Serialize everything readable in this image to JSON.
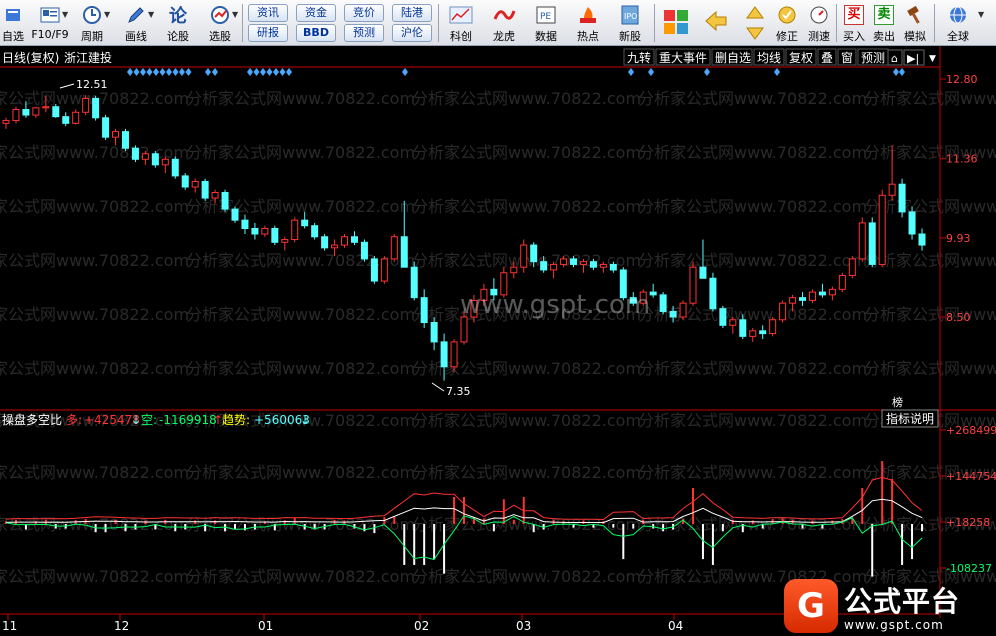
{
  "toolbar": {
    "buttons": [
      {
        "label": "自选",
        "icon": "star-icon"
      },
      {
        "label": "F10/F9",
        "icon": "info-icon"
      },
      {
        "label": "周期",
        "icon": "clock-icon"
      },
      {
        "label": "画线",
        "icon": "pencil-icon"
      },
      {
        "label": "论股",
        "icon": "discuss-icon"
      },
      {
        "label": "选股",
        "icon": "select-icon"
      }
    ],
    "small": [
      "资讯",
      "资金",
      "竞价",
      "陆港",
      "研报",
      "BBD",
      "预测",
      "沪伦"
    ],
    "buttons2": [
      {
        "label": "科创",
        "icon": "chart-icon"
      },
      {
        "label": "龙虎",
        "icon": "dragon-icon"
      },
      {
        "label": "数据",
        "icon": "pe-icon"
      },
      {
        "label": "热点",
        "icon": "hot-icon"
      },
      {
        "label": "新股",
        "icon": "ipo-icon"
      }
    ],
    "right": [
      {
        "label": "修正",
        "icon": "modify-icon"
      },
      {
        "label": "测速",
        "icon": "speed-icon"
      },
      {
        "label": "买入",
        "icon": "buy-icon",
        "glyph": "买"
      },
      {
        "label": "卖出",
        "icon": "sell-icon",
        "glyph": "卖"
      },
      {
        "label": "模拟",
        "icon": "hammer-icon"
      },
      {
        "label": "全球",
        "icon": "globe-icon"
      }
    ]
  },
  "chart": {
    "period_label": "日线(复权)",
    "stock_name": "浙江建投",
    "menu": [
      "九转",
      "重大事件",
      "删自选",
      "均线",
      "复权",
      "叠",
      "窗",
      "预测"
    ],
    "price_axis": [
      "12.80",
      "11.36",
      "9.93",
      "8.50"
    ],
    "high_label": "12.51",
    "low_label": "7.35",
    "indicator": {
      "name": "操盘多空比",
      "bull_label": "多:",
      "bull_value": "+425478",
      "bear_label": "空:",
      "bear_value": "-1169918",
      "trend_label": "趋势:",
      "trend_value": "+560063",
      "axis": [
        "+268499",
        "+144754",
        "+18258",
        "-108237"
      ],
      "explain": "指标说明",
      "tag": "榜"
    },
    "date_axis": [
      "11",
      "12",
      "01",
      "02",
      "03",
      "04"
    ],
    "watermark": "分析家公式网www.70822.com",
    "site_watermark": "www.gspt.com",
    "colors": {
      "up": "#ff3333",
      "down": "#54ffff",
      "axis": "#c00000"
    }
  },
  "chart_data": {
    "type": "candlestick",
    "price_range": [
      7.0,
      13.0
    ],
    "high": 12.51,
    "low": 7.35,
    "candles": [
      [
        12.0,
        12.1,
        11.9,
        12.05
      ],
      [
        12.05,
        12.3,
        12.0,
        12.25
      ],
      [
        12.25,
        12.4,
        12.1,
        12.15
      ],
      [
        12.15,
        12.3,
        12.1,
        12.28
      ],
      [
        12.28,
        12.5,
        12.2,
        12.3
      ],
      [
        12.3,
        12.35,
        12.1,
        12.12
      ],
      [
        12.12,
        12.2,
        11.95,
        12.0
      ],
      [
        12.0,
        12.25,
        11.98,
        12.2
      ],
      [
        12.2,
        12.51,
        12.15,
        12.45
      ],
      [
        12.45,
        12.5,
        12.05,
        12.1
      ],
      [
        12.1,
        12.15,
        11.7,
        11.75
      ],
      [
        11.75,
        11.9,
        11.6,
        11.85
      ],
      [
        11.85,
        11.9,
        11.5,
        11.55
      ],
      [
        11.55,
        11.6,
        11.3,
        11.35
      ],
      [
        11.35,
        11.5,
        11.25,
        11.45
      ],
      [
        11.45,
        11.5,
        11.2,
        11.25
      ],
      [
        11.25,
        11.4,
        11.1,
        11.35
      ],
      [
        11.35,
        11.4,
        11.0,
        11.05
      ],
      [
        11.05,
        11.1,
        10.8,
        10.85
      ],
      [
        10.85,
        11.0,
        10.75,
        10.95
      ],
      [
        10.95,
        11.0,
        10.6,
        10.65
      ],
      [
        10.65,
        10.8,
        10.55,
        10.75
      ],
      [
        10.75,
        10.8,
        10.4,
        10.45
      ],
      [
        10.45,
        10.5,
        10.2,
        10.25
      ],
      [
        10.25,
        10.35,
        10.0,
        10.1
      ],
      [
        10.1,
        10.2,
        9.9,
        10.0
      ],
      [
        10.0,
        10.15,
        9.95,
        10.1
      ],
      [
        10.1,
        10.15,
        9.8,
        9.85
      ],
      [
        9.85,
        9.95,
        9.7,
        9.9
      ],
      [
        9.9,
        10.3,
        9.85,
        10.25
      ],
      [
        10.25,
        10.4,
        10.1,
        10.15
      ],
      [
        10.15,
        10.2,
        9.9,
        9.95
      ],
      [
        9.95,
        10.0,
        9.7,
        9.75
      ],
      [
        9.75,
        9.9,
        9.6,
        9.8
      ],
      [
        9.8,
        10.0,
        9.75,
        9.95
      ],
      [
        9.95,
        10.05,
        9.8,
        9.85
      ],
      [
        9.85,
        9.9,
        9.5,
        9.55
      ],
      [
        9.55,
        9.6,
        9.1,
        9.15
      ],
      [
        9.15,
        9.6,
        9.1,
        9.55
      ],
      [
        9.55,
        10.0,
        9.5,
        9.95
      ],
      [
        9.95,
        10.6,
        9.9,
        9.4
      ],
      [
        9.4,
        9.5,
        8.8,
        8.85
      ],
      [
        8.85,
        9.0,
        8.3,
        8.4
      ],
      [
        8.4,
        8.5,
        7.9,
        8.05
      ],
      [
        8.05,
        8.2,
        7.35,
        7.6
      ],
      [
        7.6,
        8.1,
        7.5,
        8.05
      ],
      [
        8.05,
        8.6,
        8.0,
        8.5
      ],
      [
        8.5,
        8.9,
        8.4,
        8.8
      ],
      [
        8.8,
        9.1,
        8.7,
        9.0
      ],
      [
        9.0,
        9.2,
        8.8,
        8.9
      ],
      [
        8.9,
        9.4,
        8.85,
        9.3
      ],
      [
        9.3,
        9.5,
        9.2,
        9.4
      ],
      [
        9.4,
        9.9,
        9.3,
        9.8
      ],
      [
        9.8,
        9.85,
        9.4,
        9.5
      ],
      [
        9.5,
        9.6,
        9.3,
        9.35
      ],
      [
        9.35,
        9.5,
        9.2,
        9.45
      ],
      [
        9.45,
        9.6,
        9.4,
        9.55
      ],
      [
        9.55,
        9.6,
        9.4,
        9.45
      ],
      [
        9.45,
        9.55,
        9.3,
        9.5
      ],
      [
        9.5,
        9.55,
        9.35,
        9.4
      ],
      [
        9.4,
        9.5,
        9.3,
        9.45
      ],
      [
        9.45,
        9.5,
        9.3,
        9.35
      ],
      [
        9.35,
        9.4,
        8.8,
        8.85
      ],
      [
        8.85,
        8.95,
        8.7,
        8.75
      ],
      [
        8.75,
        9.0,
        8.7,
        8.95
      ],
      [
        8.95,
        9.1,
        8.85,
        8.9
      ],
      [
        8.9,
        8.95,
        8.55,
        8.6
      ],
      [
        8.6,
        8.7,
        8.4,
        8.5
      ],
      [
        8.5,
        8.8,
        8.45,
        8.75
      ],
      [
        8.75,
        9.5,
        8.7,
        9.4
      ],
      [
        9.4,
        9.9,
        9.3,
        9.2
      ],
      [
        9.2,
        9.3,
        8.6,
        8.65
      ],
      [
        8.65,
        8.7,
        8.3,
        8.35
      ],
      [
        8.35,
        8.5,
        8.2,
        8.45
      ],
      [
        8.45,
        8.55,
        8.1,
        8.15
      ],
      [
        8.15,
        8.3,
        8.05,
        8.25
      ],
      [
        8.25,
        8.35,
        8.1,
        8.2
      ],
      [
        8.2,
        8.5,
        8.15,
        8.45
      ],
      [
        8.45,
        8.8,
        8.4,
        8.75
      ],
      [
        8.75,
        8.9,
        8.6,
        8.85
      ],
      [
        8.85,
        8.95,
        8.7,
        8.8
      ],
      [
        8.8,
        9.0,
        8.75,
        8.95
      ],
      [
        8.95,
        9.1,
        8.85,
        8.9
      ],
      [
        8.9,
        9.05,
        8.8,
        9.0
      ],
      [
        9.0,
        9.3,
        8.95,
        9.25
      ],
      [
        9.25,
        9.6,
        9.2,
        9.55
      ],
      [
        9.55,
        10.3,
        9.5,
        10.2
      ],
      [
        10.2,
        10.3,
        9.4,
        9.45
      ],
      [
        9.45,
        10.8,
        9.4,
        10.7
      ],
      [
        10.7,
        11.6,
        10.6,
        10.9
      ],
      [
        10.9,
        11.0,
        10.3,
        10.4
      ],
      [
        10.4,
        10.5,
        9.9,
        10.0
      ],
      [
        10.0,
        10.1,
        9.7,
        9.8
      ]
    ]
  }
}
